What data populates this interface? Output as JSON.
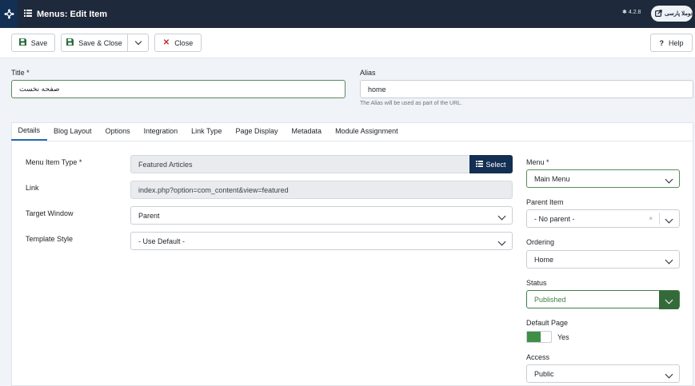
{
  "header": {
    "title": "Menus: Edit Item",
    "version": "4.2.8",
    "site_label": "جوملا پارسی"
  },
  "toolbar": {
    "save_label": "Save",
    "save_close_label": "Save & Close",
    "close_label": "Close",
    "help_label": "Help"
  },
  "form": {
    "title_label": "Title *",
    "title_value": "صفحه نخست",
    "alias_label": "Alias",
    "alias_value": "home",
    "alias_hint": "The Alias will be used as part of the URL."
  },
  "tabs": [
    {
      "label": "Details"
    },
    {
      "label": "Blog Layout"
    },
    {
      "label": "Options"
    },
    {
      "label": "Integration"
    },
    {
      "label": "Link Type"
    },
    {
      "label": "Page Display"
    },
    {
      "label": "Metadata"
    },
    {
      "label": "Module Assignment"
    }
  ],
  "details": {
    "menu_item_type_label": "Menu Item Type *",
    "menu_item_type_value": "Featured Articles",
    "select_label": "Select",
    "link_label": "Link",
    "link_value": "index.php?option=com_content&view=featured",
    "target_window_label": "Target Window",
    "target_window_value": "Parent",
    "template_style_label": "Template Style",
    "template_style_value": "- Use Default -"
  },
  "sidebar": {
    "menu_label": "Menu *",
    "menu_value": "Main Menu",
    "parent_label": "Parent Item",
    "parent_value": "- No parent -",
    "ordering_label": "Ordering",
    "ordering_value": "Home",
    "status_label": "Status",
    "status_value": "Published",
    "default_page_label": "Default Page",
    "default_page_value": "Yes",
    "access_label": "Access",
    "access_value": "Public"
  },
  "colors": {
    "header_bg": "#1e293b",
    "accent": "#132f53",
    "success": "#3f8f47",
    "danger": "#c52827"
  }
}
